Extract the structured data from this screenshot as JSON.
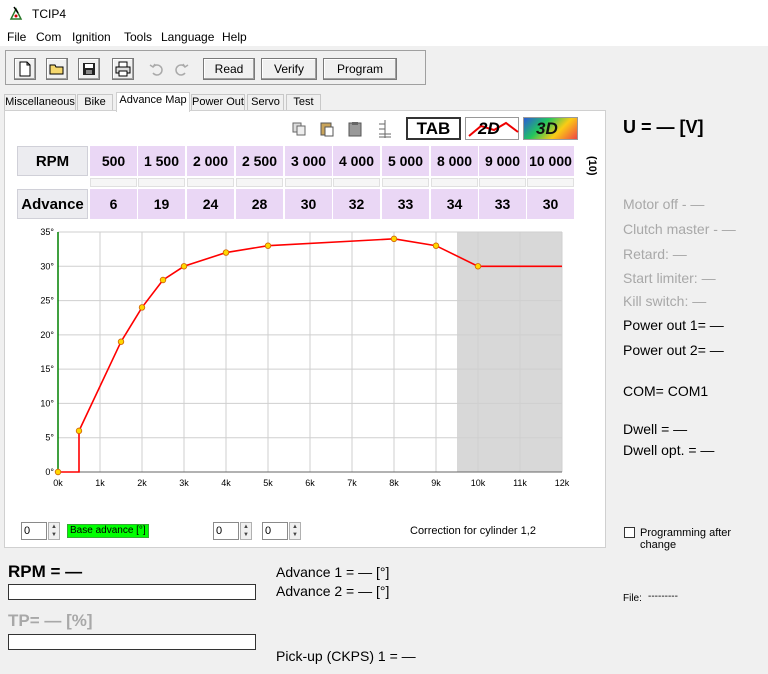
{
  "window": {
    "title": "TCIP4"
  },
  "menu": [
    "File",
    "Com",
    "Ignition",
    "Tools",
    "Language",
    "Help"
  ],
  "toolbar": {
    "icons": [
      "new-file-icon",
      "open-folder-icon",
      "save-disk-icon",
      "print-icon",
      "undo-icon",
      "redo-icon"
    ],
    "read_label": "Read",
    "verify_label": "Verify",
    "program_label": "Program"
  },
  "tabs": [
    "Miscellaneous",
    "Bike",
    "Advance Map",
    "Power Out",
    "Servo",
    "Test"
  ],
  "active_tab": "Advance Map",
  "map_toolbar": {
    "tab_label": "TAB",
    "view_2d_label": "2D",
    "view_3d_label": "3D"
  },
  "table": {
    "rpm_label": "RPM",
    "advance_label": "Advance",
    "rpm_values": [
      "500",
      "1 500",
      "2 000",
      "2 500",
      "3 000",
      "4 000",
      "5 000",
      "8 000",
      "9 000",
      "10 000"
    ],
    "advance_values": [
      "6",
      "19",
      "24",
      "28",
      "30",
      "32",
      "33",
      "34",
      "33",
      "30"
    ],
    "count_label": "(10)"
  },
  "chart_data": {
    "type": "line",
    "x": [
      0,
      500,
      500,
      1500,
      2000,
      2500,
      3000,
      4000,
      5000,
      8000,
      9000,
      10000,
      12000
    ],
    "y": [
      0,
      0,
      6,
      19,
      24,
      28,
      30,
      32,
      33,
      34,
      33,
      30,
      30
    ],
    "points_x": [
      0,
      500,
      1500,
      2000,
      2500,
      3000,
      4000,
      5000,
      8000,
      9000,
      10000
    ],
    "points_y": [
      0,
      6,
      19,
      24,
      28,
      30,
      32,
      33,
      34,
      33,
      30
    ],
    "xlim": [
      0,
      12000
    ],
    "ylim": [
      0,
      35
    ],
    "x_ticks": [
      "0k",
      "1k",
      "2k",
      "3k",
      "4k",
      "5k",
      "6k",
      "7k",
      "8k",
      "9k",
      "10k",
      "11k",
      "12k"
    ],
    "y_ticks": [
      "0°",
      "5°",
      "10°",
      "15°",
      "20°",
      "25°",
      "30°",
      "35°"
    ],
    "shaded_from_x": 9500,
    "grid": true,
    "line_color": "#ff0000",
    "point_color": "#ffd700"
  },
  "controls": {
    "spin1_value": "0",
    "base_advance_label": "Base advance [°]",
    "spin2_value": "0",
    "spin3_value": "0",
    "correction_label": "Correction for cylinder 1,2"
  },
  "right_panel": {
    "voltage": "U = — [V]",
    "motor_off": "Motor off - —",
    "clutch_master": "Clutch master - —",
    "retard": "Retard: —",
    "start_limiter": "Start limiter: —",
    "kill_switch": "Kill switch: —",
    "power_out_1": "Power out 1= —",
    "power_out_2": "Power out 2= —",
    "com": "COM= COM1",
    "dwell": "Dwell = —",
    "dwell_opt": "Dwell opt. = —",
    "programming_after_change": "Programming after change",
    "file_label": "File:",
    "file_value": "---------"
  },
  "bottom": {
    "rpm": "RPM = —",
    "tp": "TP= — [%]",
    "advance_1": "Advance 1 = — [°]",
    "advance_2": "Advance 2 = — [°]",
    "pickup": "Pick-up (CKPS) 1 = —"
  },
  "colors": {
    "table_cell": "#ead7f5",
    "base_advance_bg": "#00ff00",
    "shaded_region": "#d8d8d8"
  }
}
